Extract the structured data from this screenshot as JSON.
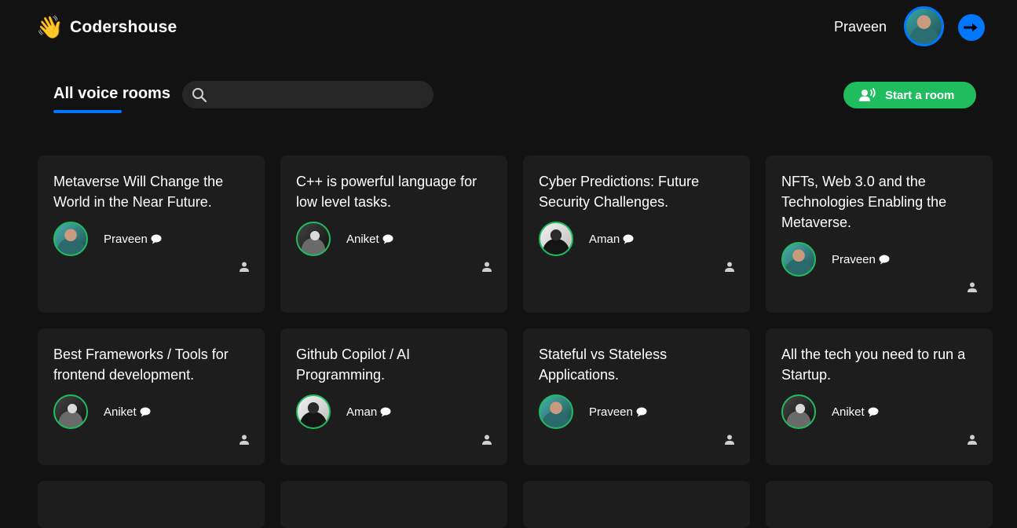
{
  "header": {
    "brand_emoji": "👋",
    "brand_name": "Codershouse",
    "user_name": "Praveen"
  },
  "toolbar": {
    "tab_label": "All voice rooms",
    "search_value": "",
    "start_label": "Start a room"
  },
  "rooms": [
    {
      "title": "Metaverse Will Change the World in the Near Future.",
      "speaker": "Praveen"
    },
    {
      "title": "C++ is powerful language for low level tasks.",
      "speaker": "Aniket"
    },
    {
      "title": "Cyber Predictions: Future Security Challenges.",
      "speaker": "Aman"
    },
    {
      "title": "NFTs, Web 3.0 and the Technologies Enabling the Metaverse.",
      "speaker": "Praveen"
    },
    {
      "title": "Best Frameworks / Tools for frontend development.",
      "speaker": "Aniket"
    },
    {
      "title": "Github Copilot / AI Programming.",
      "speaker": "Aman"
    },
    {
      "title": "Stateful vs Stateless Applications.",
      "speaker": "Praveen"
    },
    {
      "title": "All the tech you need to run a Startup.",
      "speaker": "Aniket"
    }
  ],
  "colors": {
    "background": "#121212",
    "card": "#1d1d1d",
    "accent_blue": "#0077ff",
    "accent_green": "#20bd5f"
  },
  "icons": [
    "waving-hand-icon",
    "logout-arrow-icon",
    "search-icon",
    "mic-user-icon",
    "chat-bubble-icon",
    "person-icon"
  ]
}
